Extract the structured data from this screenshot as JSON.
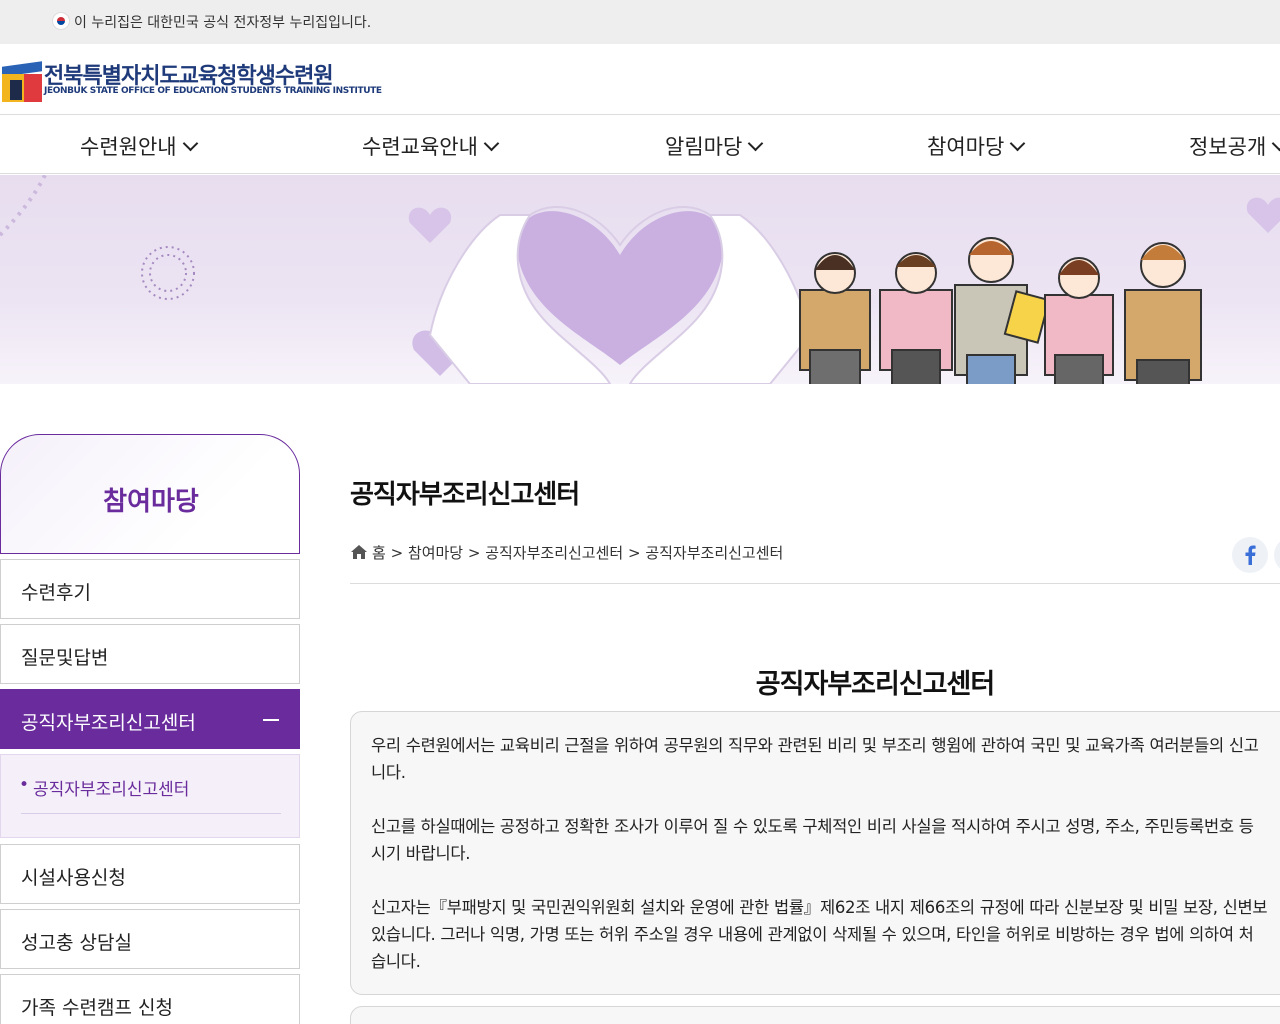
{
  "gov_bar": {
    "text": "이 누리집은 대한민국 공식 전자정부 누리집입니다."
  },
  "logo": {
    "name": "전북특별자치도교육청학생수련원",
    "en": "JEONBUK STATE OFFICE OF EDUCATION STUDENTS TRAINING INSTITUTE"
  },
  "gnb": {
    "items": [
      {
        "label": "수련원안내"
      },
      {
        "label": "수련교육안내"
      },
      {
        "label": "알림마당"
      },
      {
        "label": "참여마당"
      },
      {
        "label": "정보공개"
      }
    ]
  },
  "sidebar": {
    "title": "참여마당",
    "items": [
      {
        "label": "수련후기"
      },
      {
        "label": "질문및답변"
      },
      {
        "label": "공직자부조리신고센터",
        "active": true
      },
      {
        "label": "시설사용신청"
      },
      {
        "label": "성고충 상담실"
      },
      {
        "label": "가족 수련캠프 신청"
      }
    ],
    "sub_items": [
      {
        "label": "공직자부조리신고센터"
      }
    ]
  },
  "content": {
    "page_title": "공직자부조리신고센터",
    "breadcrumb": "홈 > 참여마당 > 공직자부조리신고센터 > 공직자부조리신고센터",
    "section_title": "공직자부조리신고센터",
    "paragraphs": [
      "우리 수련원에서는 교육비리 근절을 위하여 공무원의 직무와 관련된 비리 및 부조리 행윔에 관하여 국민 및 교육가족 여러분들의 신고\n니다.",
      "신고를 하실때에는 공정하고 정확한 조사가 이루어 질 수 있도록 구체적인 비리 사실을 적시하여 주시고 성명, 주소, 주민등록번호 등\n시기 바랍니다.",
      "신고자는『부패방지 및 국민권익위원회 설치와 운영에 관한 법률』제62조 내지 제66조의 규정에 따라 신분보장 및 비밀 보장, 신변보\n있습니다. 그러나 익명, 가명 또는 허위 주소일 경우 내용에 관계없이 삭제될 수 있으며, 타인을 허위로 비방하는 경우 법에 의하여 처\n습니다."
    ]
  },
  "colors": {
    "accent": "#6a2c9d",
    "banner_bg": "#e7ddef",
    "logo_blue": "#1e3a7a"
  },
  "icons": [
    "korea-flag-icon",
    "chevron-down-icon",
    "home-icon",
    "facebook-icon",
    "minus-icon"
  ]
}
